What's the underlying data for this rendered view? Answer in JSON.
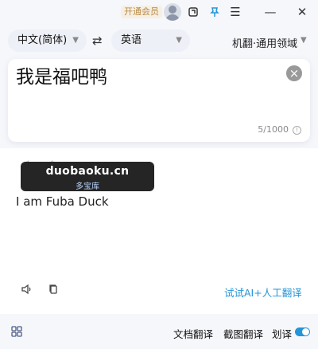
{
  "titlebar": {
    "vip_label": "开通会员",
    "icons": [
      "user-avatar",
      "toggle-screen-icon",
      "pin-icon",
      "menu-icon",
      "minimize-icon",
      "close-icon"
    ]
  },
  "languages": {
    "source": "中文(简体)",
    "target": "英语",
    "engine": "机翻·通用领域"
  },
  "source": {
    "text": "我是福吧鸭",
    "count": "5/1000"
  },
  "result": {
    "text": "I am Fuba Duck",
    "ai_link": "试试AI+人工翻译"
  },
  "watermark": {
    "main": "duobaoku.cn",
    "sub": "多宝库"
  },
  "bottom": {
    "document_translate": "文档翻译",
    "screenshot_translate": "截图翻译",
    "selection_translate": "划译",
    "selection_enabled": true
  },
  "colors": {
    "accent": "#2495d8",
    "vip": "#b98a45"
  }
}
